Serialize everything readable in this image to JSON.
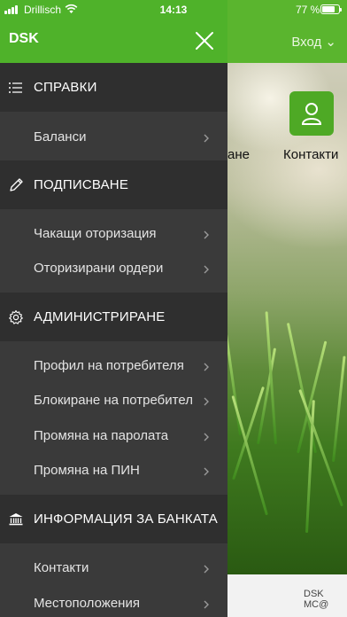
{
  "status_bar": {
    "carrier": "Drillisch",
    "time": "14:13",
    "battery_percent": "77 %",
    "battery_level": 0.77
  },
  "background": {
    "login_label": "Вход ⌄",
    "tile_label": "Контакти",
    "tile_label_partial": "ане",
    "footer_text": "DSK MC@"
  },
  "drawer": {
    "title": "DSK",
    "sections": [
      {
        "label": "СПРАВКИ",
        "icon": "list-icon",
        "items": [
          {
            "label": "Баланси"
          }
        ]
      },
      {
        "label": "ПОДПИСВАНЕ",
        "icon": "pencil-icon",
        "items": [
          {
            "label": "Чакащи оторизация"
          },
          {
            "label": "Оторизирани ордери"
          }
        ]
      },
      {
        "label": "АДМИНИСТРИРАНЕ",
        "icon": "gear-icon",
        "items": [
          {
            "label": "Профил на потребителя"
          },
          {
            "label": "Блокиране на потребител"
          },
          {
            "label": "Промяна на паролата"
          },
          {
            "label": "Промяна на ПИН"
          }
        ]
      },
      {
        "label": "ИНФОРМАЦИЯ ЗА БАНКАТА",
        "icon": "bank-icon",
        "items": [
          {
            "label": "Контакти"
          },
          {
            "label": "Местоположения"
          }
        ]
      }
    ]
  },
  "colors": {
    "brand_green": "#4fb22a",
    "drawer_bg": "#3a3a3a",
    "section_bg": "#2f2f2f"
  }
}
